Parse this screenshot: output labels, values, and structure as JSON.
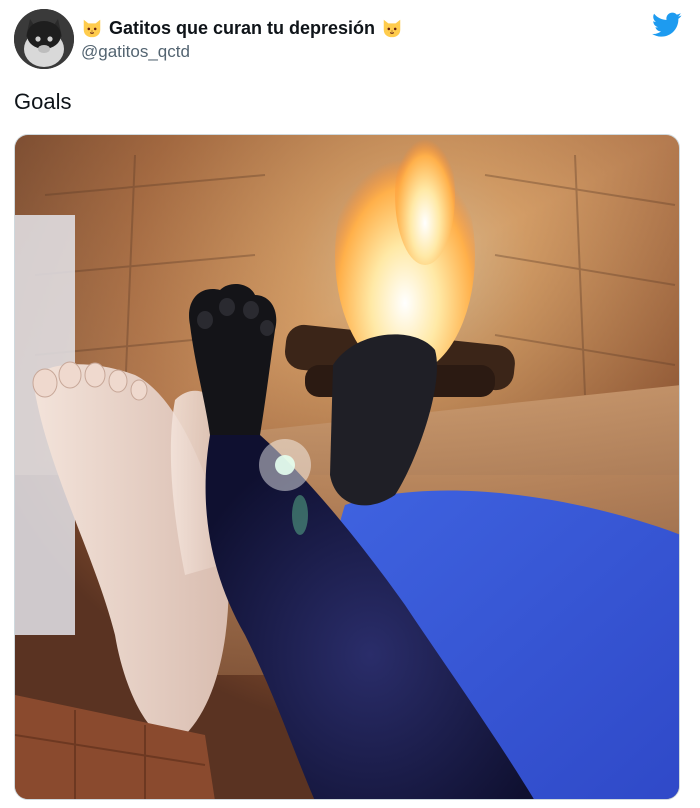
{
  "author": {
    "display_name": "Gatitos que curan tu depresión",
    "handle": "@gatitos_qctd",
    "name_emoji": "cat-face-emoji"
  },
  "tweet": {
    "text": "Goals"
  },
  "icons": {
    "brand": "twitter-bird-icon"
  },
  "colors": {
    "brand_blue": "#1d9bf0",
    "handle_gray": "#536471",
    "text": "#0f1419"
  },
  "media": {
    "kind": "photo",
    "subject": "fireplace-feet-cat-paw"
  }
}
